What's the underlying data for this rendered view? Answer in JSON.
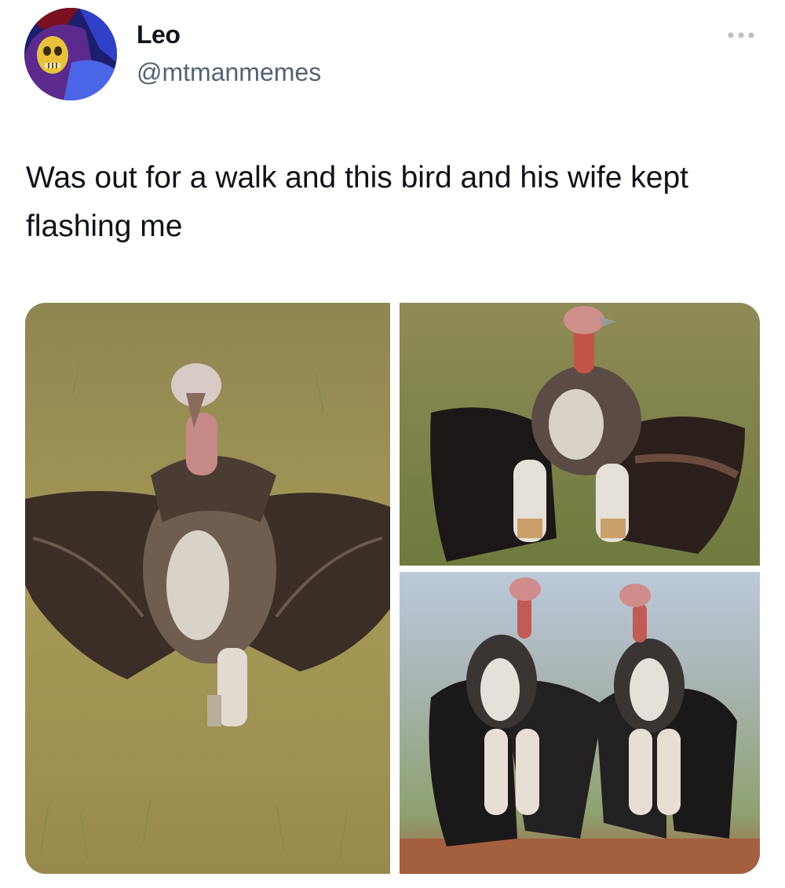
{
  "tweet": {
    "author": {
      "display_name": "Leo",
      "handle": "@mtmanmemes",
      "avatar_icon": "skeletor-avatar-icon"
    },
    "more_icon": "more-horizontal-icon",
    "text": "Was out for a walk and this bird and his wife kept flashing me",
    "media": {
      "photos": [
        {
          "subject": "vulture with wings spread"
        },
        {
          "subject": "vulture with wings spread"
        },
        {
          "subject": "two vultures with wings spread"
        }
      ]
    }
  },
  "colors": {
    "text_primary": "#0f1419",
    "text_secondary": "#536471",
    "avatar_bg": "#2a2f9c",
    "grass": "#9a8a4a"
  }
}
